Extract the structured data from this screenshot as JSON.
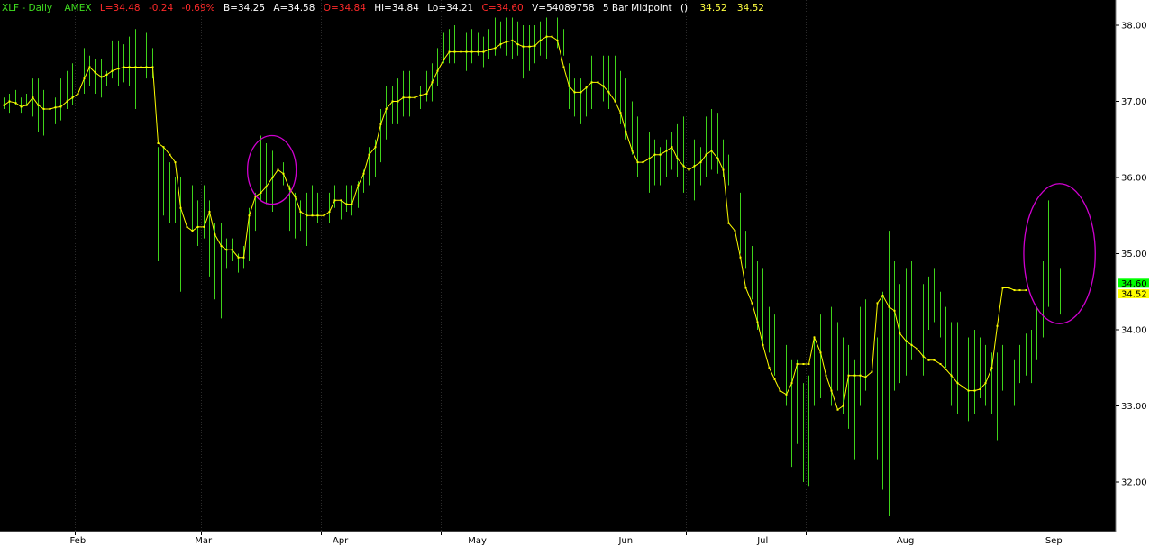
{
  "header": {
    "symbol": "XLF - Daily",
    "exchange": "AMEX",
    "last": "L=34.48",
    "change": "-0.24",
    "pct": "-0.69%",
    "bid": "B=34.25",
    "ask": "A=34.58",
    "open": "O=34.84",
    "high": "Hi=34.84",
    "low": "Lo=34.21",
    "close": "C=34.60",
    "volume": "V=54089758",
    "study": "5 Bar Midpoint",
    "study_params": "()",
    "study_val1": "34.52",
    "study_val2": "34.52"
  },
  "colors": {
    "background": "#000000",
    "bars": "#3fd41a",
    "midpoint": "#ffff00",
    "ellipse": "#d000d0",
    "axis_bg": "#ffffff",
    "grid": "#2a2a2a",
    "header_green": "#40e020",
    "header_red": "#ff2a2a",
    "header_white": "#ffffff",
    "header_yellow": "#ffff40",
    "last_price_box": "#00ff00",
    "midpoint_box": "#ffff00"
  },
  "chart_data": {
    "type": "bar",
    "y_ticks": [
      "38.00",
      "37.00",
      "36.00",
      "35.00",
      "34.00",
      "33.00",
      "32.00"
    ],
    "ylim": [
      31.4,
      38.25
    ],
    "months": [
      "Feb",
      "Mar",
      "Apr",
      "May",
      "Jun",
      "Jul",
      "Aug",
      "Sep"
    ],
    "last_price": "34.60",
    "last_midpoint": "34.52",
    "bars": [
      {
        "h": 37.05,
        "l": 36.9
      },
      {
        "h": 37.1,
        "l": 36.85
      },
      {
        "h": 37.15,
        "l": 36.95
      },
      {
        "h": 37.05,
        "l": 36.85
      },
      {
        "h": 37.1,
        "l": 36.95
      },
      {
        "h": 37.3,
        "l": 36.8
      },
      {
        "h": 37.3,
        "l": 36.6
      },
      {
        "h": 37.15,
        "l": 36.55
      },
      {
        "h": 37.0,
        "l": 36.6
      },
      {
        "h": 37.05,
        "l": 36.7
      },
      {
        "h": 37.3,
        "l": 36.75
      },
      {
        "h": 37.4,
        "l": 36.9
      },
      {
        "h": 37.5,
        "l": 36.95
      },
      {
        "h": 37.6,
        "l": 36.9
      },
      {
        "h": 37.7,
        "l": 37.1
      },
      {
        "h": 37.6,
        "l": 37.2
      },
      {
        "h": 37.55,
        "l": 37.1
      },
      {
        "h": 37.55,
        "l": 37.05
      },
      {
        "h": 37.4,
        "l": 37.2
      },
      {
        "h": 37.8,
        "l": 37.3
      },
      {
        "h": 37.8,
        "l": 37.2
      },
      {
        "h": 37.75,
        "l": 37.25
      },
      {
        "h": 37.85,
        "l": 37.2
      },
      {
        "h": 37.95,
        "l": 36.9
      },
      {
        "h": 37.8,
        "l": 37.2
      },
      {
        "h": 37.9,
        "l": 37.3
      },
      {
        "h": 37.7,
        "l": 37.3
      },
      {
        "h": 36.4,
        "l": 34.9
      },
      {
        "h": 36.4,
        "l": 35.5
      },
      {
        "h": 36.2,
        "l": 35.4
      },
      {
        "h": 36.0,
        "l": 35.4
      },
      {
        "h": 36.0,
        "l": 34.5
      },
      {
        "h": 35.8,
        "l": 35.2
      },
      {
        "h": 35.9,
        "l": 35.3
      },
      {
        "h": 35.7,
        "l": 35.1
      },
      {
        "h": 35.9,
        "l": 35.2
      },
      {
        "h": 35.7,
        "l": 34.7
      },
      {
        "h": 35.4,
        "l": 34.4
      },
      {
        "h": 35.4,
        "l": 34.15
      },
      {
        "h": 35.2,
        "l": 34.8
      },
      {
        "h": 35.2,
        "l": 34.9
      },
      {
        "h": 35.0,
        "l": 34.75
      },
      {
        "h": 35.1,
        "l": 34.8
      },
      {
        "h": 35.6,
        "l": 34.9
      },
      {
        "h": 35.8,
        "l": 35.3
      },
      {
        "h": 36.55,
        "l": 35.7
      },
      {
        "h": 36.45,
        "l": 35.65
      },
      {
        "h": 36.35,
        "l": 35.55
      },
      {
        "h": 36.3,
        "l": 35.7
      },
      {
        "h": 36.2,
        "l": 35.9
      },
      {
        "h": 35.9,
        "l": 35.3
      },
      {
        "h": 35.8,
        "l": 35.2
      },
      {
        "h": 35.7,
        "l": 35.3
      },
      {
        "h": 35.8,
        "l": 35.1
      },
      {
        "h": 35.9,
        "l": 35.5
      },
      {
        "h": 35.8,
        "l": 35.4
      },
      {
        "h": 35.8,
        "l": 35.5
      },
      {
        "h": 35.8,
        "l": 35.4
      },
      {
        "h": 35.9,
        "l": 35.6
      },
      {
        "h": 35.7,
        "l": 35.45
      },
      {
        "h": 35.9,
        "l": 35.55
      },
      {
        "h": 35.9,
        "l": 35.5
      },
      {
        "h": 35.95,
        "l": 35.6
      },
      {
        "h": 36.1,
        "l": 35.8
      },
      {
        "h": 36.4,
        "l": 35.9
      },
      {
        "h": 36.5,
        "l": 36.0
      },
      {
        "h": 36.9,
        "l": 36.2
      },
      {
        "h": 37.2,
        "l": 36.5
      },
      {
        "h": 37.2,
        "l": 36.7
      },
      {
        "h": 37.3,
        "l": 36.7
      },
      {
        "h": 37.4,
        "l": 36.8
      },
      {
        "h": 37.4,
        "l": 36.8
      },
      {
        "h": 37.3,
        "l": 36.8
      },
      {
        "h": 37.2,
        "l": 36.9
      },
      {
        "h": 37.4,
        "l": 37.0
      },
      {
        "h": 37.5,
        "l": 37.0
      },
      {
        "h": 37.7,
        "l": 37.2
      },
      {
        "h": 37.9,
        "l": 37.5
      },
      {
        "h": 37.95,
        "l": 37.5
      },
      {
        "h": 38.0,
        "l": 37.5
      },
      {
        "h": 37.9,
        "l": 37.5
      },
      {
        "h": 37.9,
        "l": 37.4
      },
      {
        "h": 37.95,
        "l": 37.5
      },
      {
        "h": 37.9,
        "l": 37.6
      },
      {
        "h": 37.85,
        "l": 37.45
      },
      {
        "h": 37.95,
        "l": 37.55
      },
      {
        "h": 38.1,
        "l": 37.6
      },
      {
        "h": 38.05,
        "l": 37.7
      },
      {
        "h": 38.1,
        "l": 37.6
      },
      {
        "h": 38.1,
        "l": 37.55
      },
      {
        "h": 38.05,
        "l": 37.6
      },
      {
        "h": 38.0,
        "l": 37.3
      },
      {
        "h": 38.0,
        "l": 37.4
      },
      {
        "h": 38.0,
        "l": 37.5
      },
      {
        "h": 38.05,
        "l": 37.6
      },
      {
        "h": 38.1,
        "l": 37.55
      },
      {
        "h": 38.2,
        "l": 37.7
      },
      {
        "h": 38.1,
        "l": 37.7
      },
      {
        "h": 37.95,
        "l": 37.6
      },
      {
        "h": 37.5,
        "l": 36.9
      },
      {
        "h": 37.3,
        "l": 36.8
      },
      {
        "h": 37.3,
        "l": 36.7
      },
      {
        "h": 37.2,
        "l": 36.8
      },
      {
        "h": 37.6,
        "l": 36.9
      },
      {
        "h": 37.7,
        "l": 37.0
      },
      {
        "h": 37.6,
        "l": 37.0
      },
      {
        "h": 37.6,
        "l": 36.9
      },
      {
        "h": 37.6,
        "l": 37.0
      },
      {
        "h": 37.4,
        "l": 36.7
      },
      {
        "h": 37.3,
        "l": 36.5
      },
      {
        "h": 37.0,
        "l": 36.3
      },
      {
        "h": 36.8,
        "l": 36.0
      },
      {
        "h": 36.7,
        "l": 35.9
      },
      {
        "h": 36.6,
        "l": 35.8
      },
      {
        "h": 36.5,
        "l": 35.9
      },
      {
        "h": 36.4,
        "l": 35.9
      },
      {
        "h": 36.5,
        "l": 36.0
      },
      {
        "h": 36.6,
        "l": 36.1
      },
      {
        "h": 36.7,
        "l": 36.0
      },
      {
        "h": 36.8,
        "l": 35.8
      },
      {
        "h": 36.6,
        "l": 35.9
      },
      {
        "h": 36.5,
        "l": 35.7
      },
      {
        "h": 36.4,
        "l": 35.9
      },
      {
        "h": 36.8,
        "l": 36.0
      },
      {
        "h": 36.9,
        "l": 36.1
      },
      {
        "h": 36.85,
        "l": 36.05
      },
      {
        "h": 36.5,
        "l": 36.0
      },
      {
        "h": 36.3,
        "l": 35.9
      },
      {
        "h": 36.1,
        "l": 35.3
      },
      {
        "h": 35.8,
        "l": 35.0
      },
      {
        "h": 35.3,
        "l": 34.8
      },
      {
        "h": 35.1,
        "l": 34.4
      },
      {
        "h": 34.9,
        "l": 34.0
      },
      {
        "h": 34.8,
        "l": 33.8
      },
      {
        "h": 34.3,
        "l": 33.7
      },
      {
        "h": 34.2,
        "l": 33.4
      },
      {
        "h": 34.0,
        "l": 33.2
      },
      {
        "h": 33.8,
        "l": 33.0
      },
      {
        "h": 33.6,
        "l": 32.2
      },
      {
        "h": 33.6,
        "l": 32.5
      },
      {
        "h": 33.3,
        "l": 32.0
      },
      {
        "h": 33.4,
        "l": 31.95
      },
      {
        "h": 33.9,
        "l": 33.0
      },
      {
        "h": 34.2,
        "l": 33.1
      },
      {
        "h": 34.4,
        "l": 32.9
      },
      {
        "h": 34.3,
        "l": 33.0
      },
      {
        "h": 34.1,
        "l": 33.2
      },
      {
        "h": 33.9,
        "l": 32.9
      },
      {
        "h": 33.8,
        "l": 32.7
      },
      {
        "h": 33.6,
        "l": 32.3
      },
      {
        "h": 34.3,
        "l": 33.0
      },
      {
        "h": 34.4,
        "l": 33.2
      },
      {
        "h": 34.0,
        "l": 32.5
      },
      {
        "h": 33.9,
        "l": 32.3
      },
      {
        "h": 34.5,
        "l": 31.9
      },
      {
        "h": 35.3,
        "l": 31.55
      },
      {
        "h": 34.9,
        "l": 33.2
      },
      {
        "h": 34.6,
        "l": 33.3
      },
      {
        "h": 34.8,
        "l": 33.4
      },
      {
        "h": 34.9,
        "l": 33.6
      },
      {
        "h": 34.9,
        "l": 33.4
      },
      {
        "h": 34.6,
        "l": 33.4
      },
      {
        "h": 34.7,
        "l": 34.0
      },
      {
        "h": 34.8,
        "l": 34.1
      },
      {
        "h": 34.5,
        "l": 33.9
      },
      {
        "h": 34.3,
        "l": 33.5
      },
      {
        "h": 34.1,
        "l": 33.0
      },
      {
        "h": 34.1,
        "l": 32.9
      },
      {
        "h": 34.0,
        "l": 32.9
      },
      {
        "h": 33.9,
        "l": 32.8
      },
      {
        "h": 34.0,
        "l": 32.9
      },
      {
        "h": 33.9,
        "l": 33.1
      },
      {
        "h": 33.8,
        "l": 33.0
      },
      {
        "h": 33.7,
        "l": 32.9
      },
      {
        "h": 33.7,
        "l": 32.55
      },
      {
        "h": 33.8,
        "l": 33.2
      },
      {
        "h": 33.7,
        "l": 33.0
      },
      {
        "h": 33.6,
        "l": 33.0
      },
      {
        "h": 33.8,
        "l": 33.3
      },
      {
        "h": 33.95,
        "l": 33.4
      },
      {
        "h": 34.0,
        "l": 33.3
      },
      {
        "h": 34.3,
        "l": 33.6
      },
      {
        "h": 34.9,
        "l": 33.9
      },
      {
        "h": 35.7,
        "l": 34.3
      },
      {
        "h": 35.3,
        "l": 34.4
      },
      {
        "h": 34.8,
        "l": 34.2
      }
    ],
    "midpoint": [
      36.95,
      37.0,
      36.98,
      36.93,
      36.95,
      37.05,
      36.95,
      36.9,
      36.9,
      36.92,
      36.93,
      37.0,
      37.05,
      37.1,
      37.3,
      37.45,
      37.38,
      37.32,
      37.35,
      37.4,
      37.43,
      37.45,
      37.45,
      37.45,
      37.45,
      37.45,
      37.45,
      36.45,
      36.4,
      36.3,
      36.2,
      35.6,
      35.35,
      35.3,
      35.35,
      35.35,
      35.55,
      35.25,
      35.1,
      35.05,
      35.05,
      34.95,
      34.95,
      35.5,
      35.75,
      35.8,
      35.88,
      36.0,
      36.1,
      36.05,
      35.85,
      35.75,
      35.55,
      35.5,
      35.5,
      35.5,
      35.5,
      35.55,
      35.7,
      35.7,
      35.65,
      35.65,
      35.9,
      36.05,
      36.3,
      36.4,
      36.7,
      36.9,
      37.0,
      37.0,
      37.05,
      37.05,
      37.05,
      37.08,
      37.1,
      37.25,
      37.4,
      37.55,
      37.65,
      37.65,
      37.65,
      37.65,
      37.65,
      37.65,
      37.65,
      37.68,
      37.7,
      37.75,
      37.78,
      37.8,
      37.75,
      37.72,
      37.72,
      37.73,
      37.8,
      37.85,
      37.85,
      37.8,
      37.45,
      37.2,
      37.12,
      37.12,
      37.18,
      37.25,
      37.25,
      37.2,
      37.12,
      37.0,
      36.85,
      36.6,
      36.35,
      36.2,
      36.2,
      36.25,
      36.3,
      36.3,
      36.35,
      36.4,
      36.25,
      36.15,
      36.1,
      36.15,
      36.2,
      36.3,
      36.35,
      36.25,
      36.1,
      35.4,
      35.3,
      34.95,
      34.55,
      34.35,
      34.1,
      33.8,
      33.5,
      33.35,
      33.2,
      33.15,
      33.3,
      33.55,
      33.55,
      33.55,
      33.9,
      33.7,
      33.4,
      33.2,
      32.95,
      33.0,
      33.4,
      33.4,
      33.4,
      33.38,
      33.45,
      34.35,
      34.45,
      34.3,
      34.25,
      33.95,
      33.85,
      33.8,
      33.75,
      33.65,
      33.6,
      33.6,
      33.55,
      33.48,
      33.4,
      33.3,
      33.25,
      33.2,
      33.2,
      33.22,
      33.3,
      33.5,
      34.05,
      34.55,
      34.55,
      34.52,
      34.52,
      34.52
    ],
    "annotations": [
      {
        "shape": "ellipse",
        "from_bar": 44,
        "to_bar": 50,
        "center_price": 36.1,
        "price_half_height": 0.45
      },
      {
        "shape": "ellipse",
        "from_bar": 180,
        "to_bar": 190,
        "center_price": 35.0,
        "price_half_height": 0.92
      }
    ],
    "month_start_bars": [
      13,
      35,
      56,
      77,
      98,
      120,
      141,
      162
    ],
    "month_label_bars": [
      13,
      35,
      59,
      83,
      109,
      133,
      158,
      184
    ],
    "grid": "vertical",
    "legend": "none"
  }
}
